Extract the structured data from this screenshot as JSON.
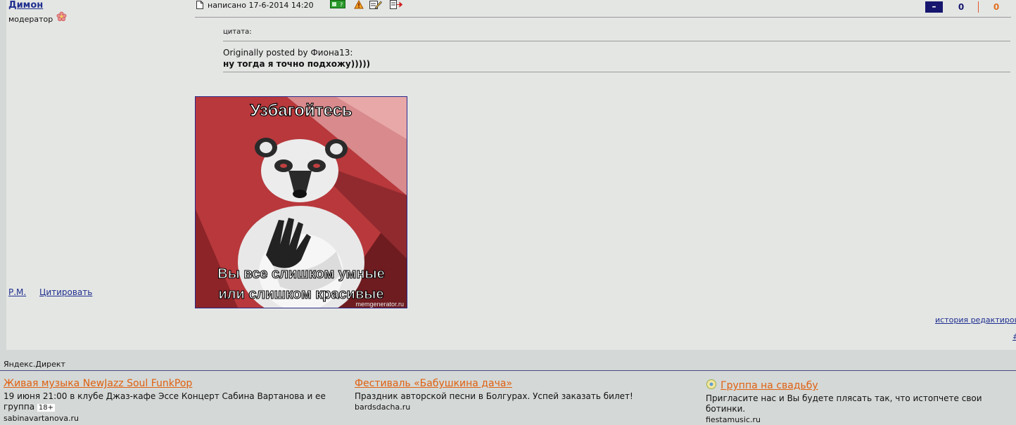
{
  "post": {
    "author": "Димон",
    "role": "модератор",
    "date": "написано 17-6-2014 14:20",
    "rating": {
      "minus_label": "–",
      "value1": "0",
      "value2": "0"
    },
    "pm_link": "Р.М.",
    "quote_link": "Цитировать",
    "quote": {
      "title": "цитата:",
      "author_line": "Originally posted by Фиона13:",
      "text": "ну тогда я точно подхожу)))))"
    },
    "image": {
      "top_text": "Узбагойтесь",
      "bottom_line1": "Вы все слишком умные",
      "bottom_line2": "или слишком красивые",
      "watermark": "memgenerator.ru"
    },
    "edit_history_link": "история редактирования",
    "hash_link": "#"
  },
  "ads": {
    "label": "Яндекс.Директ",
    "items": [
      {
        "title": "Живая музыка NewJazz Soul FunkPop",
        "text": "19 июня 21:00 в клубе Джаз-кафе Эссе Концерт Сабина Вартанова и ее группа",
        "badge": "18+",
        "domain": "sabinavartanova.ru"
      },
      {
        "title": "Фестиваль «Бабушкина дача»",
        "text": "Праздник авторской песни в Болгурах. Успей заказать билет!",
        "domain": "bardsdacha.ru"
      },
      {
        "title": "Группа на свадьбу",
        "text": "Пригласите нас и Вы будете плясать так, что истопчете свои ботинки.",
        "domain": "fiestamusic.ru"
      }
    ]
  },
  "icons": [
    "user-online-icon",
    "report-icon",
    "edit-icon",
    "delete-icon",
    "document-icon",
    "moderator-flower-icon",
    "ad-favicon-icon"
  ]
}
